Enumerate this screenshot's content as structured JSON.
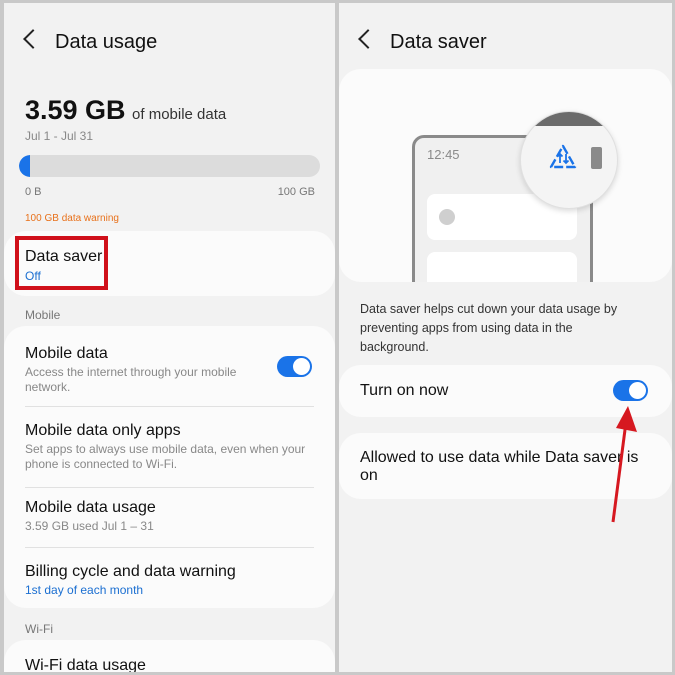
{
  "left": {
    "header": {
      "title": "Data usage"
    },
    "usage": {
      "amount": "3.59 GB",
      "suffix": "of mobile data",
      "period": "Jul 1 - Jul 31",
      "bar_fill_percent": 3.59,
      "min_label": "0 B",
      "max_label": "100 GB",
      "warning": "100 GB data warning"
    },
    "data_saver": {
      "title": "Data saver",
      "status": "Off"
    },
    "mobile_section": "Mobile",
    "mobile_data": {
      "title": "Mobile data",
      "desc": "Access the internet through your mobile network.",
      "enabled": true
    },
    "mobile_only_apps": {
      "title": "Mobile data only apps",
      "desc": "Set apps to always use mobile data, even when your phone is connected to Wi-Fi."
    },
    "mobile_data_usage": {
      "title": "Mobile data usage",
      "desc": "3.59 GB used Jul 1 – 31"
    },
    "billing": {
      "title": "Billing cycle and data warning",
      "link": "1st day of each month"
    },
    "wifi_section": "Wi-Fi",
    "wifi_usage": {
      "title": "Wi-Fi data usage"
    }
  },
  "right": {
    "header": {
      "title": "Data saver"
    },
    "illustration": {
      "time": "12:45"
    },
    "description": "Data saver helps cut down your data usage by preventing apps from using data in the background.",
    "turn_on": {
      "label": "Turn on now",
      "enabled": true
    },
    "allowed": {
      "label": "Allowed to use data while Data saver is on"
    }
  },
  "colors": {
    "accent": "#1a73e8",
    "warning": "#e8711b",
    "highlight_box": "#d0101a",
    "arrow": "#d61820"
  }
}
